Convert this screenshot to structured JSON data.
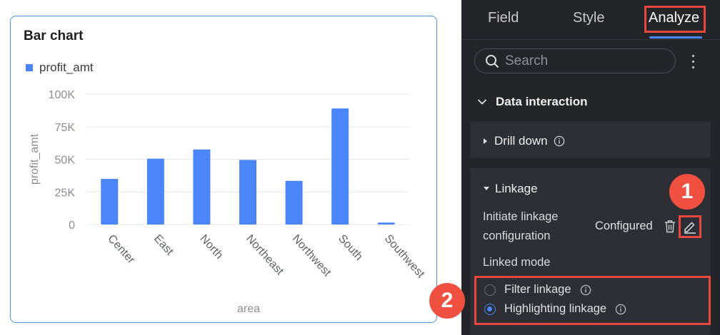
{
  "chart": {
    "title": "Bar chart",
    "legend_label": "profit_amt",
    "colors": {
      "bar": "#4a86f7",
      "border": "#4a90e2"
    }
  },
  "chart_data": {
    "type": "bar",
    "title": "Bar chart",
    "xlabel": "area",
    "ylabel": "profit_amt",
    "categories": [
      "Center",
      "East",
      "North",
      "Northeast",
      "Northwest",
      "South",
      "Southwest"
    ],
    "series": [
      {
        "name": "profit_amt",
        "values": [
          35000,
          50500,
          57500,
          49500,
          33500,
          89000,
          1500
        ]
      }
    ],
    "ylim": [
      0,
      100000
    ],
    "y_ticks": [
      0,
      25000,
      50000,
      75000,
      100000
    ],
    "y_tick_labels": [
      "0",
      "25K",
      "50K",
      "75K",
      "100K"
    ],
    "grid": true,
    "legend_position": "top-left"
  },
  "panel": {
    "tabs": [
      "Field",
      "Style",
      "Analyze"
    ],
    "active_tab": "Analyze",
    "search_placeholder": "Search",
    "more_icon": "more-vertical-icon",
    "section_title": "Data interaction",
    "drill_down": {
      "label": "Drill down",
      "icon": "info-icon"
    },
    "linkage": {
      "label": "Linkage",
      "initiate_label_line1": "Initiate linkage",
      "initiate_label_line2": "configuration",
      "status": "Configured",
      "delete_icon": "trash-icon",
      "edit_icon": "edit-icon",
      "mode_label": "Linked mode",
      "modes": [
        {
          "label": "Filter linkage",
          "selected": false
        },
        {
          "label": "Highlighting linkage",
          "selected": true
        }
      ]
    },
    "accent": "#4a86f7",
    "highlight_color": "#e8473f"
  },
  "badges": [
    "1",
    "2"
  ]
}
